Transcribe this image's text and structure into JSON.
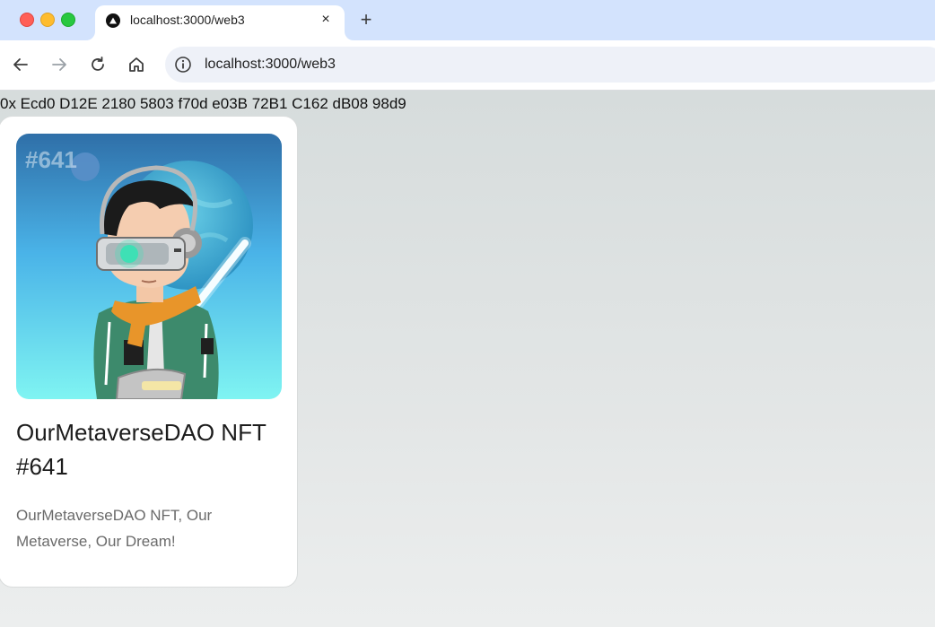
{
  "browser": {
    "tab_title": "localhost:3000/web3",
    "url": "localhost:3000/web3",
    "close_glyph": "×",
    "new_tab_glyph": "+"
  },
  "page": {
    "wallet_address": "0x Ecd0 D12E 2180 5803 f70d e03B 72B1 C162 dB08 98d9",
    "nft": {
      "badge": "#641",
      "title": "OurMetaverseDAO NFT #641",
      "description": "OurMetaverseDAO NFT, Our Metaverse, Our Dream!"
    }
  },
  "colors": {
    "tabstrip": "#d3e3fd",
    "page_bg": "#d6dcdc",
    "card_bg": "#ffffff",
    "nft_sky_top": "#2f6fa8",
    "nft_sky_bottom": "#7ff4f2",
    "jacket": "#3d8a6c",
    "scarf": "#e8952a",
    "visor_glow": "#3ee0b5"
  },
  "icons": [
    "back-arrow-icon",
    "forward-arrow-icon",
    "reload-icon",
    "home-icon",
    "site-info-icon",
    "vercel-triangle-icon",
    "close-icon",
    "plus-icon"
  ]
}
